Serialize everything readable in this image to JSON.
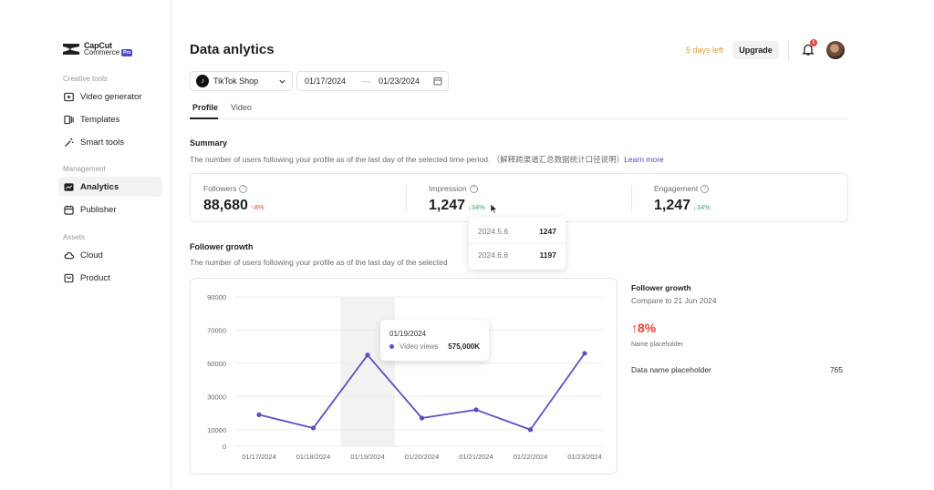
{
  "brand": {
    "line1": "CapCut",
    "line2": "Commerce",
    "badge": "Pro"
  },
  "sidebar": {
    "sections": [
      {
        "title": "Creative tools",
        "items": [
          {
            "label": "Video generator",
            "icon": "video-add-icon"
          },
          {
            "label": "Templates",
            "icon": "templates-icon"
          },
          {
            "label": "Smart tools",
            "icon": "magic-wand-icon"
          }
        ]
      },
      {
        "title": "Management",
        "items": [
          {
            "label": "Analytics",
            "icon": "analytics-icon",
            "active": true
          },
          {
            "label": "Publisher",
            "icon": "calendar-icon"
          }
        ]
      },
      {
        "title": "Assets",
        "items": [
          {
            "label": "Cloud",
            "icon": "cloud-icon"
          },
          {
            "label": "Product",
            "icon": "product-icon"
          }
        ]
      }
    ]
  },
  "header": {
    "title": "Data anlytics",
    "trial": "5 days left",
    "upgrade": "Upgrade",
    "notifications": "6"
  },
  "filters": {
    "shop": "TikTok Shop",
    "date_start": "01/17/2024",
    "date_separator": "—",
    "date_end": "01/23/2024"
  },
  "tabs": [
    {
      "label": "Profile",
      "active": true
    },
    {
      "label": "Video",
      "active": false
    }
  ],
  "summary": {
    "title": "Summary",
    "description": "The number of users following your profile as of the last day of the selected time period. （解释跨渠道汇总数据统计口径说明）",
    "learn_more": "Learn more",
    "metrics": [
      {
        "label": "Followers",
        "value": "88,680",
        "delta": "↑8%",
        "direction": "up"
      },
      {
        "label": "Impression",
        "value": "1,247",
        "delta": "↓34%",
        "direction": "down"
      },
      {
        "label": "Engagement",
        "value": "1,247",
        "delta": "↓34%",
        "direction": "down"
      }
    ]
  },
  "impression_popover": [
    {
      "date": "2024.5.6",
      "value": "1247"
    },
    {
      "date": "2024.6.6",
      "value": "1197"
    }
  ],
  "follower_growth": {
    "title": "Follower growth",
    "description": "The number of users following your profile as of the last day of the selected"
  },
  "chart_data": {
    "type": "line",
    "categories": [
      "01/17/2024",
      "01/18/2024",
      "01/19/2024",
      "01/20/2024",
      "01/21/2024",
      "01/22/2024",
      "01/23/2024"
    ],
    "series": [
      {
        "name": "Video views",
        "values": [
          19000,
          11000,
          55000,
          17000,
          22000,
          10000,
          56000
        ]
      }
    ],
    "y_ticks": [
      "90000",
      "70000",
      "50000",
      "30000",
      "10000",
      "0"
    ],
    "ylim": [
      0,
      90000
    ],
    "highlight_category": "01/19/2024",
    "grid": true,
    "color": "#5b4fc4"
  },
  "chart_tooltip": {
    "date": "01/19/2024",
    "series": "Video views",
    "value": "575,000K"
  },
  "side_panel": {
    "title": "Follower growth",
    "compare": "Compare to 21 Jun 2024",
    "big_value": "↑8%",
    "placeholder": "Name placeholder",
    "row_label": "Data name placeholder",
    "row_value": "765"
  }
}
